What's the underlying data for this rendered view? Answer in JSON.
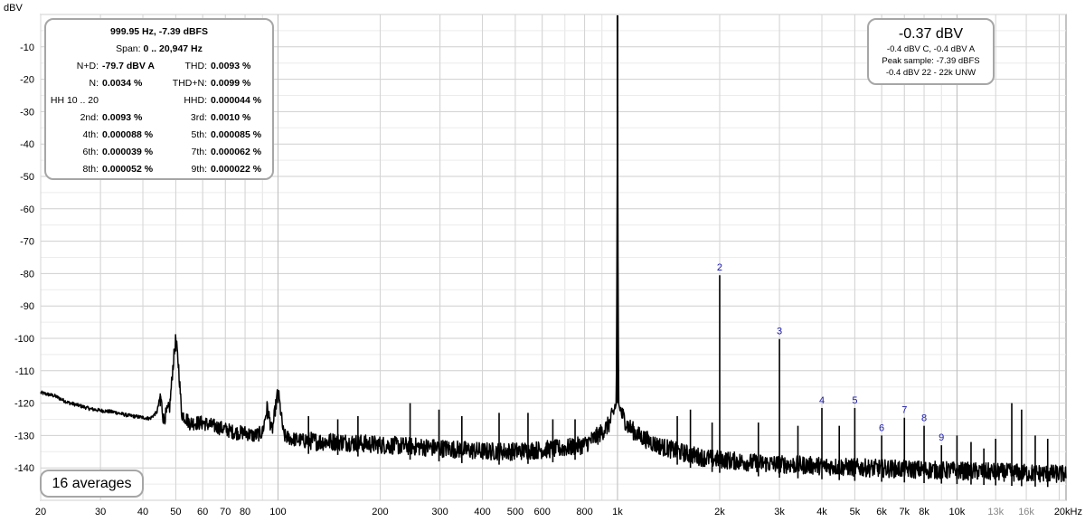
{
  "chart_data": {
    "type": "line",
    "ylabel": "dBV",
    "xscale": "log",
    "xlim": [
      20,
      20947
    ],
    "ylim": [
      -150,
      0
    ],
    "y_ticks": [
      -10,
      -20,
      -30,
      -40,
      -50,
      -60,
      -70,
      -80,
      -90,
      -100,
      -110,
      -120,
      -130,
      -140
    ],
    "x_ticks": [
      {
        "value": 20,
        "label": "20"
      },
      {
        "value": 30,
        "label": "30"
      },
      {
        "value": 40,
        "label": "40"
      },
      {
        "value": 50,
        "label": "50"
      },
      {
        "value": 60,
        "label": "60"
      },
      {
        "value": 70,
        "label": "70"
      },
      {
        "value": 80,
        "label": "80"
      },
      {
        "value": 100,
        "label": "100"
      },
      {
        "value": 200,
        "label": "200"
      },
      {
        "value": 300,
        "label": "300"
      },
      {
        "value": 400,
        "label": "400"
      },
      {
        "value": 500,
        "label": "500"
      },
      {
        "value": 600,
        "label": "600"
      },
      {
        "value": 800,
        "label": "800"
      },
      {
        "value": 1000,
        "label": "1k"
      },
      {
        "value": 2000,
        "label": "2k"
      },
      {
        "value": 3000,
        "label": "3k"
      },
      {
        "value": 4000,
        "label": "4k"
      },
      {
        "value": 5000,
        "label": "5k"
      },
      {
        "value": 6000,
        "label": "6k"
      },
      {
        "value": 7000,
        "label": "7k"
      },
      {
        "value": 8000,
        "label": "8k"
      },
      {
        "value": 10000,
        "label": "10k"
      },
      {
        "value": 13000,
        "label": "13k"
      },
      {
        "value": 16000,
        "label": "16k"
      },
      {
        "value": 20000,
        "label": "20kHz"
      }
    ],
    "grid": true,
    "color": "#000000",
    "series": [
      {
        "points": [
          [
            20,
            -117
          ],
          [
            22,
            -118
          ],
          [
            24,
            -120
          ],
          [
            26,
            -121
          ],
          [
            28,
            -122
          ],
          [
            30,
            -122.5
          ],
          [
            33,
            -123
          ],
          [
            36,
            -124
          ],
          [
            39,
            -124.5
          ],
          [
            42,
            -125
          ],
          [
            44,
            -123
          ],
          [
            45,
            -118
          ],
          [
            46,
            -126
          ],
          [
            48,
            -122
          ],
          [
            49,
            -110
          ],
          [
            50,
            -101
          ],
          [
            51,
            -110
          ],
          [
            52,
            -124
          ],
          [
            55,
            -127
          ],
          [
            60,
            -127
          ],
          [
            65,
            -128
          ],
          [
            70,
            -129
          ],
          [
            75,
            -130
          ],
          [
            80,
            -130
          ],
          [
            85,
            -131
          ],
          [
            90,
            -130
          ],
          [
            93,
            -122
          ],
          [
            96,
            -130
          ],
          [
            100,
            -117
          ],
          [
            104,
            -131
          ],
          [
            110,
            -132
          ],
          [
            130,
            -133
          ],
          [
            150,
            -133
          ],
          [
            200,
            -134
          ],
          [
            250,
            -134.5
          ],
          [
            300,
            -135
          ],
          [
            400,
            -136
          ],
          [
            500,
            -136
          ],
          [
            600,
            -135.5
          ],
          [
            700,
            -135
          ],
          [
            800,
            -134
          ],
          [
            880,
            -131
          ],
          [
            940,
            -128
          ],
          [
            975,
            -124
          ],
          [
            992,
            -120
          ],
          [
            998,
            -60
          ],
          [
            1000,
            0
          ],
          [
            1002,
            -60
          ],
          [
            1008,
            -120
          ],
          [
            1025,
            -124
          ],
          [
            1070,
            -128
          ],
          [
            1150,
            -131
          ],
          [
            1300,
            -134
          ],
          [
            1500,
            -136
          ],
          [
            1800,
            -138
          ],
          [
            2000,
            -138.5
          ],
          [
            2500,
            -139.5
          ],
          [
            3000,
            -140
          ],
          [
            4000,
            -140.5
          ],
          [
            5000,
            -141
          ],
          [
            7000,
            -141.5
          ],
          [
            10000,
            -142
          ],
          [
            14000,
            -142.5
          ],
          [
            20000,
            -143
          ],
          [
            20947,
            -143
          ]
        ],
        "noise_db": 4
      }
    ],
    "spurs": [
      [
        50,
        -101
      ],
      [
        45,
        -117
      ],
      [
        93,
        -121
      ],
      [
        100,
        -117
      ],
      [
        123,
        -124
      ],
      [
        150,
        -125
      ],
      [
        172,
        -124
      ],
      [
        245,
        -120
      ],
      [
        298,
        -122
      ],
      [
        348,
        -124
      ],
      [
        448,
        -123
      ],
      [
        545,
        -123
      ],
      [
        645,
        -125
      ],
      [
        750,
        -125
      ],
      [
        1500,
        -124
      ],
      [
        1640,
        -122
      ],
      [
        1900,
        -126
      ],
      [
        2000,
        -80.5
      ],
      [
        2600,
        -126
      ],
      [
        3000,
        -100.2
      ],
      [
        3400,
        -127
      ],
      [
        4000,
        -121.5
      ],
      [
        4500,
        -127
      ],
      [
        5000,
        -121.5
      ],
      [
        6000,
        -130
      ],
      [
        7000,
        -124.5
      ],
      [
        8000,
        -127
      ],
      [
        9000,
        -133
      ],
      [
        10000,
        -130
      ],
      [
        11000,
        -132
      ],
      [
        12000,
        -134
      ],
      [
        13000,
        -131
      ],
      [
        14500,
        -120
      ],
      [
        15500,
        -122
      ],
      [
        17000,
        -130
      ],
      [
        18500,
        -131
      ]
    ],
    "harmonic_markers": [
      {
        "label": "2",
        "x": 2000,
        "y": -80.5
      },
      {
        "label": "3",
        "x": 3000,
        "y": -100.2
      },
      {
        "label": "4",
        "x": 4000,
        "y": -121.5
      },
      {
        "label": "5",
        "x": 5000,
        "y": -121.5
      },
      {
        "label": "6",
        "x": 6000,
        "y": -130
      },
      {
        "label": "7",
        "x": 7000,
        "y": -124.5
      },
      {
        "label": "8",
        "x": 8000,
        "y": -127
      },
      {
        "label": "9",
        "x": 9000,
        "y": -133
      }
    ]
  },
  "stats": {
    "fund": "999.95 Hz, -7.39 dBFS",
    "span_label": "Span:",
    "span_value": "0 .. 20,947 Hz",
    "rows": [
      {
        "l1": "N+D:",
        "v1": "-79.7 dBV A",
        "l2": "THD:",
        "v2": "0.0093 %"
      },
      {
        "l1": "N:",
        "v1": "0.0034 %",
        "l2": "THD+N:",
        "v2": "0.0099 %"
      },
      {
        "l1": "HH 10 .. 20",
        "v1": "",
        "l2": "HHD:",
        "v2": "0.000044 %"
      },
      {
        "l1": "2nd:",
        "v1": "0.0093 %",
        "l2": "3rd:",
        "v2": "0.0010 %"
      },
      {
        "l1": "4th:",
        "v1": "0.000088 %",
        "l2": "5th:",
        "v2": "0.000085 %"
      },
      {
        "l1": "6th:",
        "v1": "0.000039 %",
        "l2": "7th:",
        "v2": "0.000062 %"
      },
      {
        "l1": "8th:",
        "v1": "0.000052 %",
        "l2": "9th:",
        "v2": "0.000022 %"
      }
    ]
  },
  "level": {
    "main": "-0.37 dBV",
    "line1": "-0.4 dBV C, -0.4 dBV A",
    "line2": "Peak sample: -7.39 dBFS",
    "line3": "-0.4 dBV 22 - 22k UNW"
  },
  "averages": "16 averages"
}
